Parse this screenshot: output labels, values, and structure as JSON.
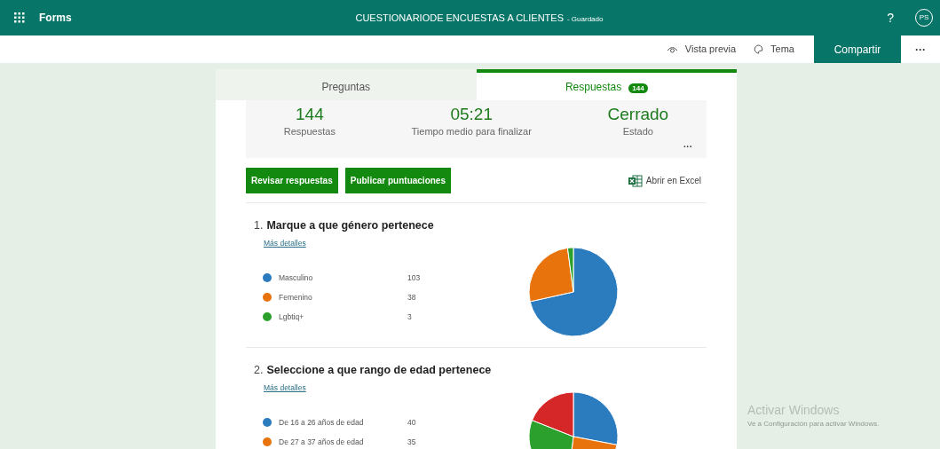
{
  "app_bar": {
    "app_name": "Forms",
    "title": "CUESTIONARIODE ENCUESTAS A CLIENTES",
    "save_status": "- Guardado",
    "help": "?",
    "avatar": "PS"
  },
  "toolbar": {
    "buttons": [
      {
        "label": "Vista previa",
        "kind": "preview"
      },
      {
        "label": "Tema",
        "kind": "theme"
      }
    ],
    "share": "Compartir",
    "more": "···"
  },
  "tabs": [
    {
      "label": "Preguntas",
      "selected": false
    },
    {
      "label": "Respuestas",
      "badge": "144",
      "selected": true
    }
  ],
  "summary": {
    "stats": [
      {
        "value": "144",
        "label": "Respuestas"
      },
      {
        "value": "05:21",
        "label": "Tiempo medio para finalizar"
      },
      {
        "value": "Cerrado",
        "label": "Estado"
      }
    ],
    "more": "···"
  },
  "actions": {
    "buttons": [
      "Revisar respuestas",
      "Publicar puntuaciones"
    ],
    "excel": "Abrir en Excel"
  },
  "questions": [
    {
      "number": "1.",
      "title": "Marque a que género pertenece",
      "details": "Más detalles",
      "options": [
        {
          "label": "Masculino",
          "count": "103",
          "color": "#2b7bbf"
        },
        {
          "label": "Femenino",
          "count": "38",
          "color": "#e8730c"
        },
        {
          "label": "Lgbtiq+",
          "count": "3",
          "color": "#2ca02c"
        }
      ],
      "chart_data": {
        "type": "pie",
        "values": [
          71.5,
          26.4,
          2.1
        ]
      }
    },
    {
      "number": "2.",
      "title": "Seleccione a que rango de edad pertenece",
      "details": "Más detalles",
      "options": [
        {
          "label": "De 16 a 26 años de edad",
          "count": "40",
          "color": "#2b7bbf"
        },
        {
          "label": "De 27 a 37 años de edad",
          "count": "35",
          "color": "#e8730c"
        }
      ]
    }
  ],
  "windows_activation": {
    "title": "Activar Windows",
    "message": "Ve a Configuración para activar Windows."
  }
}
